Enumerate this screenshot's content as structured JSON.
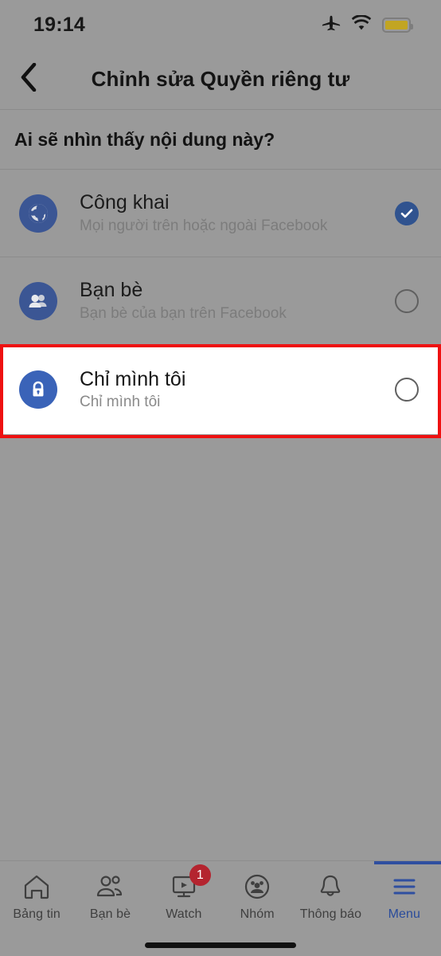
{
  "status_bar": {
    "time": "19:14",
    "icons": [
      "airplane-mode-icon",
      "wifi-icon",
      "battery-icon"
    ],
    "battery_color": "#c2a522"
  },
  "header": {
    "back_icon": "chevron-left-icon",
    "title": "Chỉnh sửa Quyền riêng tư"
  },
  "section": {
    "title": "Ai sẽ nhìn thấy nội dung này?"
  },
  "options": [
    {
      "icon": "globe-icon",
      "title": "Công khai",
      "subtitle": "Mọi người trên hoặc ngoài Facebook",
      "selected": true,
      "highlighted": false
    },
    {
      "icon": "friends-icon",
      "title": "Bạn bè",
      "subtitle": "Bạn bè của bạn trên Facebook",
      "selected": false,
      "highlighted": false
    },
    {
      "icon": "lock-icon",
      "title": "Chỉ mình tôi",
      "subtitle": "Chỉ mình tôi",
      "selected": false,
      "highlighted": true
    }
  ],
  "annotation": {
    "type": "red-highlight-box",
    "color": "#ee1111",
    "target": "Chỉ mình tôi"
  },
  "bottom_nav": {
    "items": [
      {
        "icon": "home-icon",
        "label": "Bảng tin",
        "active": false,
        "badge": null
      },
      {
        "icon": "friends-outline-icon",
        "label": "Bạn bè",
        "active": false,
        "badge": null
      },
      {
        "icon": "watch-icon",
        "label": "Watch",
        "active": false,
        "badge": "1"
      },
      {
        "icon": "groups-icon",
        "label": "Nhóm",
        "active": false,
        "badge": null
      },
      {
        "icon": "bell-icon",
        "label": "Thông báo",
        "active": false,
        "badge": null
      },
      {
        "icon": "hamburger-menu-icon",
        "label": "Menu",
        "active": true,
        "badge": null
      }
    ],
    "active_color": "#2a4c9b"
  }
}
